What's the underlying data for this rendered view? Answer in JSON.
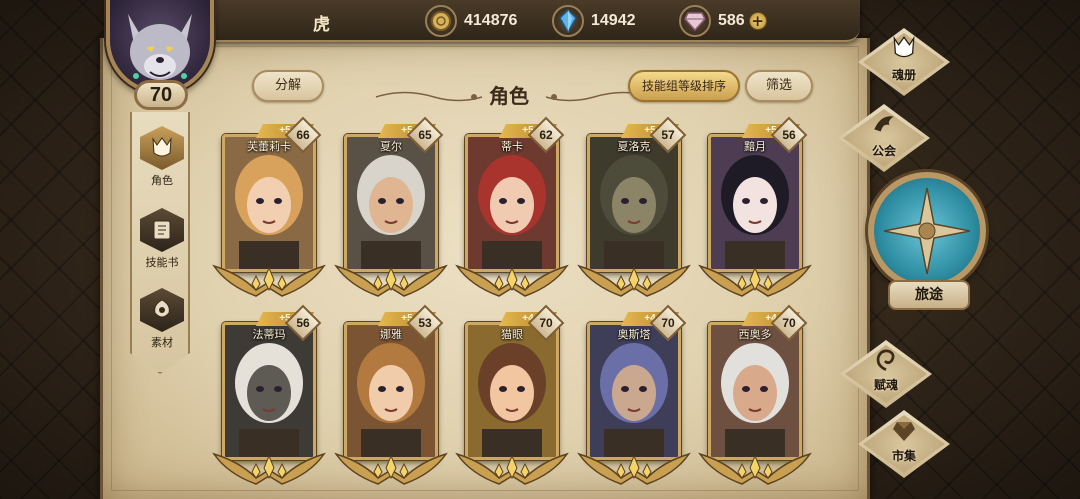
{
  "player": {
    "name": "虎",
    "level": "70"
  },
  "resources": [
    {
      "icon": "gold-coin-icon",
      "value": "414876"
    },
    {
      "icon": "blue-crystal-icon",
      "value": "14942"
    },
    {
      "icon": "pink-gem-icon",
      "value": "586"
    }
  ],
  "sidebar": {
    "items": [
      {
        "label": "角色",
        "icon": "helmet-icon",
        "active": true
      },
      {
        "label": "技能书",
        "icon": "book-icon",
        "active": false
      },
      {
        "label": "素材",
        "icon": "material-icon",
        "active": false
      }
    ]
  },
  "header": {
    "title": "角色",
    "decompose_label": "分解",
    "sort_label": "技能组等级排序",
    "filter_label": "筛选"
  },
  "characters": [
    {
      "name": "芙蕾莉卡",
      "plus": "+5",
      "level": "66",
      "hair": "#d9a25c",
      "skin": "#f1cfb0",
      "bg": "#8a6a45"
    },
    {
      "name": "夏尔",
      "plus": "+5",
      "level": "65",
      "hair": "#d8d4cc",
      "skin": "#e0b692",
      "bg": "#5a5146"
    },
    {
      "name": "蒂卡",
      "plus": "+5",
      "level": "62",
      "hair": "#a8342d",
      "skin": "#f0cbb2",
      "bg": "#6e3a30"
    },
    {
      "name": "夏洛克",
      "plus": "+5",
      "level": "57",
      "hair": "#4d4b3a",
      "skin": "#8c8466",
      "bg": "#3e3a2c"
    },
    {
      "name": "黯月",
      "plus": "+5",
      "level": "56",
      "hair": "#1f1b26",
      "skin": "#f2e3e0",
      "bg": "#4d3c52"
    },
    {
      "name": "法蒂玛",
      "plus": "+5",
      "level": "56",
      "hair": "#e5e0d8",
      "skin": "#5e5a54",
      "bg": "#3e3a36"
    },
    {
      "name": "娜雅",
      "plus": "+5",
      "level": "53",
      "hair": "#b27a3e",
      "skin": "#f0ccaa",
      "bg": "#7b5434"
    },
    {
      "name": "猫眼",
      "plus": "+4",
      "level": "70",
      "hair": "#6b4029",
      "skin": "#f2c6a0",
      "bg": "#8a6a2e"
    },
    {
      "name": "奥斯塔",
      "plus": "+4",
      "level": "70",
      "hair": "#6a6fa8",
      "skin": "#c9a88f",
      "bg": "#3e3e58"
    },
    {
      "name": "西奥多",
      "plus": "+4",
      "level": "70",
      "hair": "#e2e0dc",
      "skin": "#d8a98a",
      "bg": "#6e5040"
    }
  ],
  "nav": {
    "soulbook_label": "魂册",
    "guild_label": "公会",
    "journey_label": "旅途",
    "talent_label": "赋魂",
    "market_label": "市集"
  },
  "colors": {
    "gold_accent": "#cda862",
    "parchment": "#e6d8b8",
    "journey_teal": "#3a9fb4"
  }
}
